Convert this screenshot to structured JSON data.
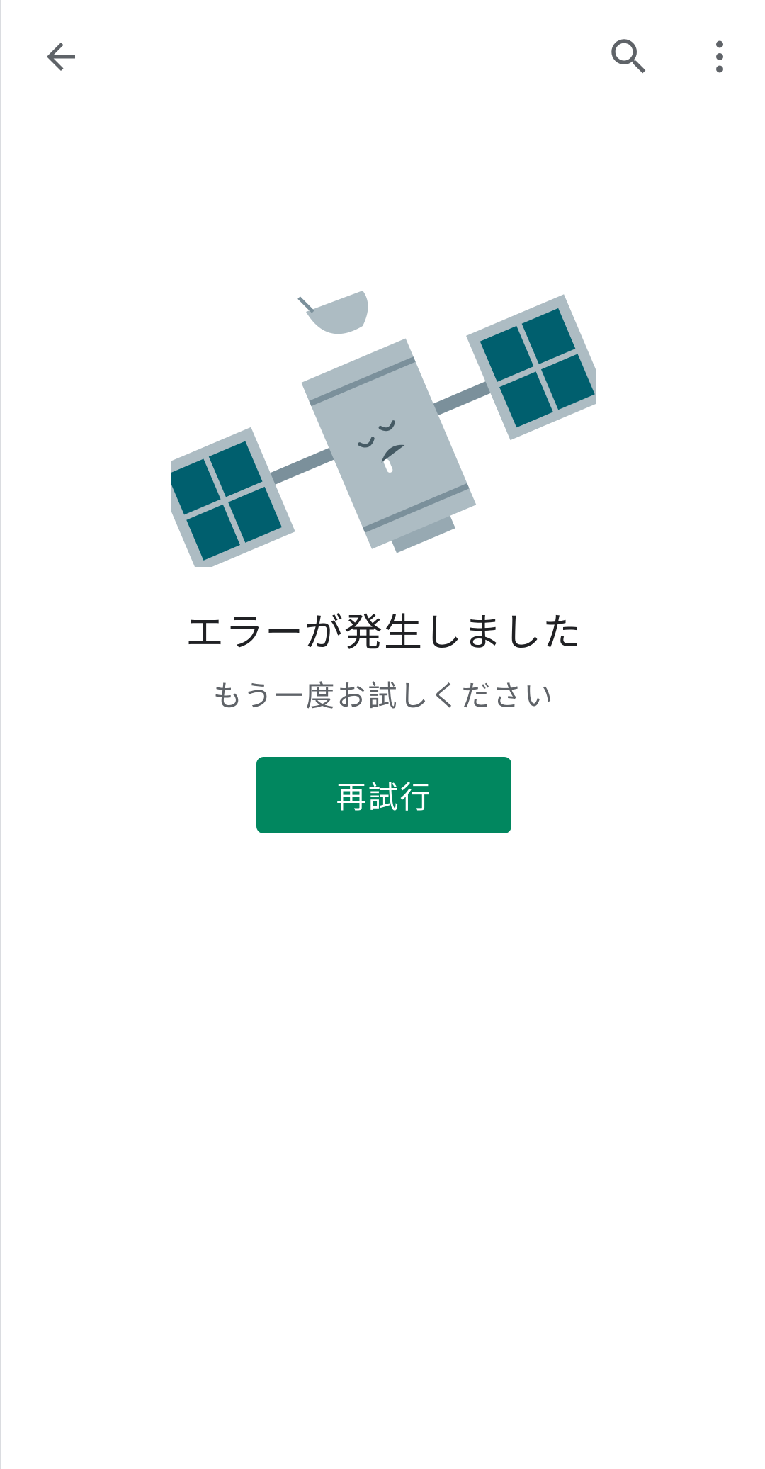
{
  "toolbar": {
    "back_icon": "arrow-back-icon",
    "search_icon": "search-icon",
    "more_icon": "more-vert-icon",
    "icon_color": "#5f6368"
  },
  "illustration": {
    "icon": "broken-satellite-illustration",
    "panel_color": "#005f6e",
    "body_color": "#adbcc3",
    "frame_color": "#adbcc3"
  },
  "error": {
    "title": "エラーが発生しました",
    "subtitle": "もう一度お試しください"
  },
  "retry": {
    "label": "再試行",
    "color": "#01875f"
  }
}
